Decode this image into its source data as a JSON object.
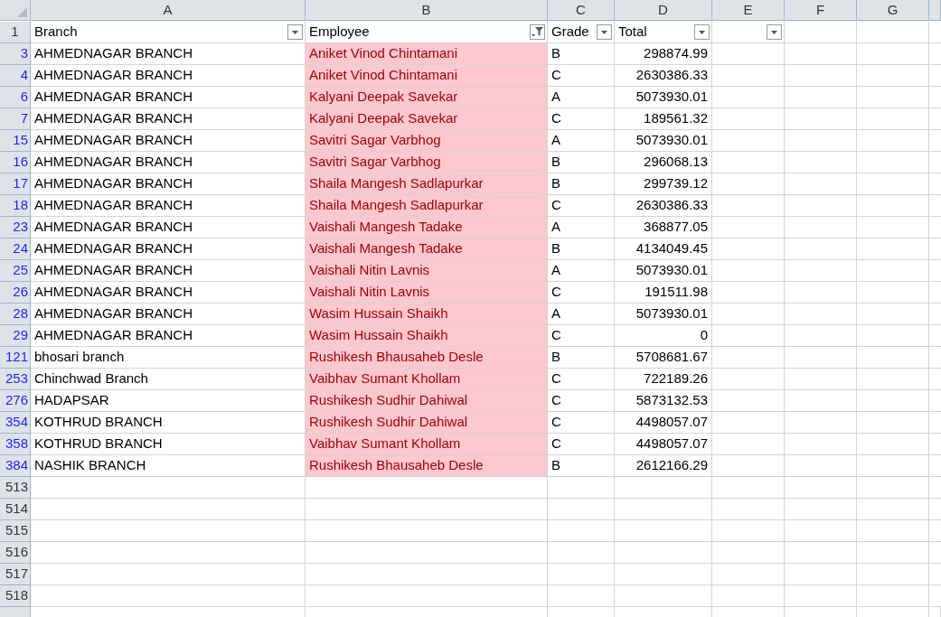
{
  "columns": [
    "A",
    "B",
    "C",
    "D",
    "E",
    "F",
    "G"
  ],
  "header_row": {
    "number": "1",
    "cells": [
      {
        "text": "Branch",
        "kind": "dropdown"
      },
      {
        "text": "Employee",
        "kind": "filtered"
      },
      {
        "text": "Grade",
        "kind": "dropdown"
      },
      {
        "text": "Total",
        "kind": "dropdown"
      },
      {
        "kind": "dropdown"
      },
      {
        "kind": "plain"
      },
      {
        "kind": "plain"
      }
    ]
  },
  "rows": [
    {
      "number": "3",
      "filtered": true,
      "branch": "AHMEDNAGAR BRANCH",
      "employee": "Aniket Vinod Chintamani",
      "highlighted": true,
      "grade": "B",
      "total": "298874.99"
    },
    {
      "number": "4",
      "filtered": true,
      "branch": "AHMEDNAGAR BRANCH",
      "employee": "Aniket Vinod Chintamani",
      "highlighted": true,
      "grade": "C",
      "total": "2630386.33"
    },
    {
      "number": "6",
      "filtered": true,
      "branch": "AHMEDNAGAR BRANCH",
      "employee": "Kalyani Deepak Savekar",
      "highlighted": true,
      "grade": "A",
      "total": "5073930.01"
    },
    {
      "number": "7",
      "filtered": true,
      "branch": "AHMEDNAGAR BRANCH",
      "employee": "Kalyani Deepak Savekar",
      "highlighted": true,
      "grade": "C",
      "total": "189561.32"
    },
    {
      "number": "15",
      "filtered": true,
      "branch": "AHMEDNAGAR BRANCH",
      "employee": "Savitri Sagar Varbhog",
      "highlighted": true,
      "grade": "A",
      "total": "5073930.01"
    },
    {
      "number": "16",
      "filtered": true,
      "branch": "AHMEDNAGAR BRANCH",
      "employee": "Savitri Sagar Varbhog",
      "highlighted": true,
      "grade": "B",
      "total": "296068.13"
    },
    {
      "number": "17",
      "filtered": true,
      "branch": "AHMEDNAGAR BRANCH",
      "employee": "Shaila Mangesh Sadlapurkar",
      "highlighted": true,
      "grade": "B",
      "total": "299739.12"
    },
    {
      "number": "18",
      "filtered": true,
      "branch": "AHMEDNAGAR BRANCH",
      "employee": "Shaila Mangesh Sadlapurkar",
      "highlighted": true,
      "grade": "C",
      "total": "2630386.33"
    },
    {
      "number": "23",
      "filtered": true,
      "branch": "AHMEDNAGAR BRANCH",
      "employee": "Vaishali Mangesh Tadake",
      "highlighted": true,
      "grade": "A",
      "total": "368877.05"
    },
    {
      "number": "24",
      "filtered": true,
      "branch": "AHMEDNAGAR BRANCH",
      "employee": "Vaishali Mangesh Tadake",
      "highlighted": true,
      "grade": "B",
      "total": "4134049.45"
    },
    {
      "number": "25",
      "filtered": true,
      "branch": "AHMEDNAGAR BRANCH",
      "employee": "Vaishali Nitin Lavnis",
      "highlighted": true,
      "grade": "A",
      "total": "5073930.01"
    },
    {
      "number": "26",
      "filtered": true,
      "branch": "AHMEDNAGAR BRANCH",
      "employee": "Vaishali Nitin Lavnis",
      "highlighted": true,
      "grade": "C",
      "total": "191511.98"
    },
    {
      "number": "28",
      "filtered": true,
      "branch": "AHMEDNAGAR BRANCH",
      "employee": "Wasim Hussain Shaikh",
      "highlighted": true,
      "grade": "A",
      "total": "5073930.01"
    },
    {
      "number": "29",
      "filtered": true,
      "branch": "AHMEDNAGAR BRANCH",
      "employee": "Wasim Hussain Shaikh",
      "highlighted": true,
      "grade": "C",
      "total": "0"
    },
    {
      "number": "121",
      "filtered": true,
      "branch": "bhosari branch",
      "employee": "Rushikesh Bhausaheb Desle",
      "highlighted": true,
      "grade": "B",
      "total": "5708681.67"
    },
    {
      "number": "253",
      "filtered": true,
      "branch": "Chinchwad Branch",
      "employee": "Vaibhav Sumant Khollam",
      "highlighted": true,
      "grade": "C",
      "total": "722189.26"
    },
    {
      "number": "276",
      "filtered": true,
      "branch": "HADAPSAR",
      "employee": "Rushikesh Sudhir Dahiwal",
      "highlighted": true,
      "grade": "C",
      "total": "5873132.53"
    },
    {
      "number": "354",
      "filtered": true,
      "branch": "KOTHRUD BRANCH",
      "employee": "Rushikesh Sudhir Dahiwal",
      "highlighted": true,
      "grade": "C",
      "total": "4498057.07"
    },
    {
      "number": "358",
      "filtered": true,
      "branch": "KOTHRUD BRANCH",
      "employee": "Vaibhav Sumant Khollam",
      "highlighted": true,
      "grade": "C",
      "total": "4498057.07"
    },
    {
      "number": "384",
      "filtered": true,
      "branch": "NASHIK BRANCH",
      "employee": "Rushikesh Bhausaheb Desle",
      "highlighted": true,
      "grade": "B",
      "total": "2612166.29"
    },
    {
      "number": "513",
      "filtered": false,
      "highlighted": false
    },
    {
      "number": "514",
      "filtered": false,
      "highlighted": false
    },
    {
      "number": "515",
      "filtered": false,
      "highlighted": false
    },
    {
      "number": "516",
      "filtered": false,
      "highlighted": false
    },
    {
      "number": "517",
      "filtered": false,
      "highlighted": false
    },
    {
      "number": "518",
      "filtered": false,
      "highlighted": false
    }
  ]
}
